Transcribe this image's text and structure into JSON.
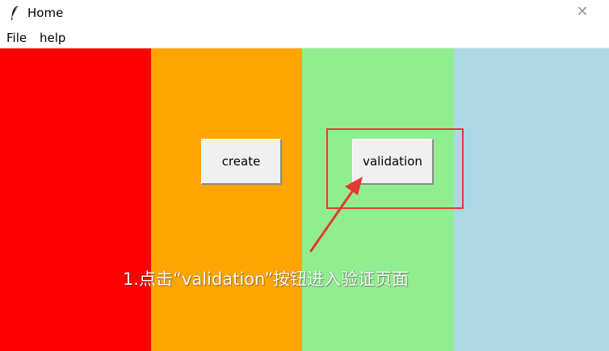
{
  "window": {
    "title": "Home",
    "close_glyph": "✕"
  },
  "menu": {
    "file": "File",
    "help": "help"
  },
  "panels": {
    "colors": [
      "#ff0000",
      "#ffa500",
      "#90ee90",
      "#add8e6"
    ]
  },
  "buttons": {
    "create": "create",
    "validation": "validation"
  },
  "annotation": {
    "text": "1.点击“validation”按钮进入验证页面",
    "highlight_color": "#e53935"
  },
  "icons": {
    "app": "feather-icon",
    "close": "close-icon"
  }
}
